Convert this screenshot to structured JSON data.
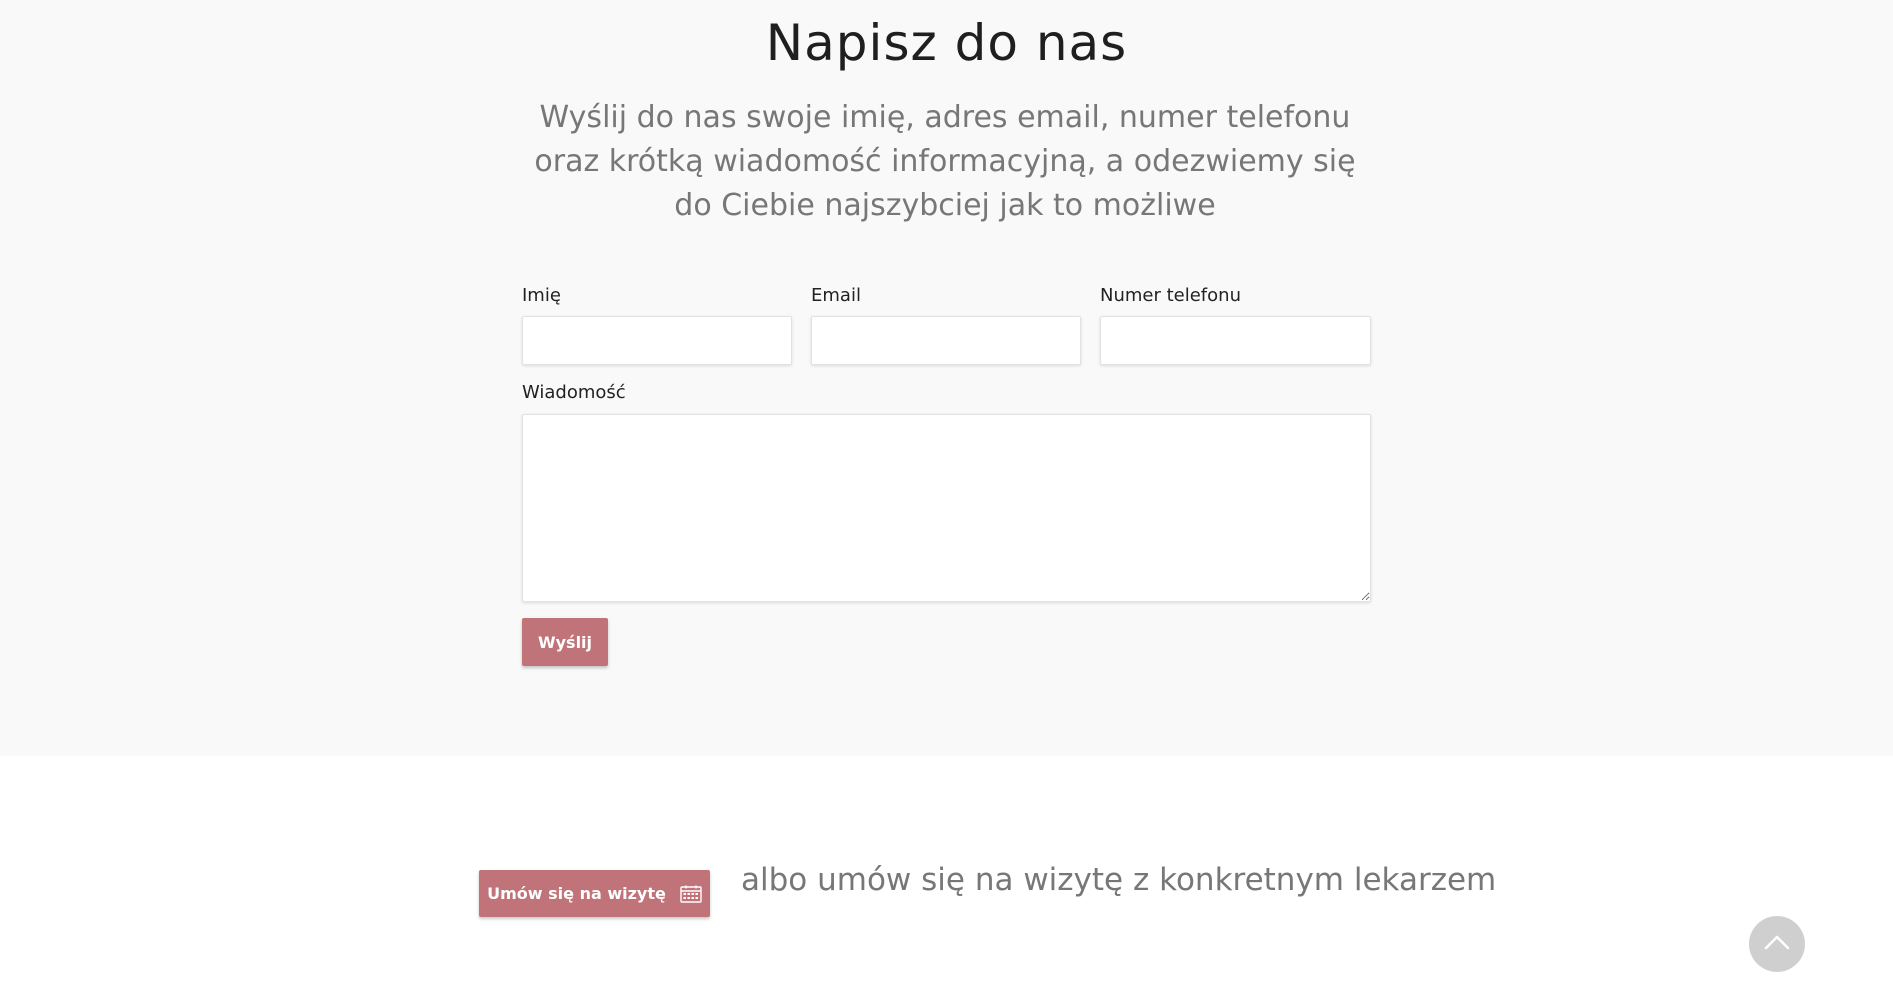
{
  "contact": {
    "title": "Napisz do nas",
    "lead": "Wyślij do nas swoje imię, adres email, numer telefonu oraz krótką wiadomość informacyjną, a odezwiemy się do Ciebie najszybciej jak to możliwe",
    "fields": {
      "name_label": "Imię",
      "name_value": "",
      "email_label": "Email",
      "email_value": "",
      "phone_label": "Numer telefonu",
      "phone_value": "",
      "message_label": "Wiadomość",
      "message_value": ""
    },
    "submit_label": "Wyślij"
  },
  "appointment": {
    "button_label": "Umów się na wizytę",
    "button_icon": "calendar-icon",
    "alt_text": "albo umów się na wizytę z konkretnym lekarzem"
  },
  "scroll_top": {
    "icon": "chevron-up-icon"
  },
  "colors": {
    "accent": "#c07479",
    "section_bg": "#f9f9f9",
    "muted_text": "#777777",
    "scroll_button": "#cfcfcf"
  }
}
